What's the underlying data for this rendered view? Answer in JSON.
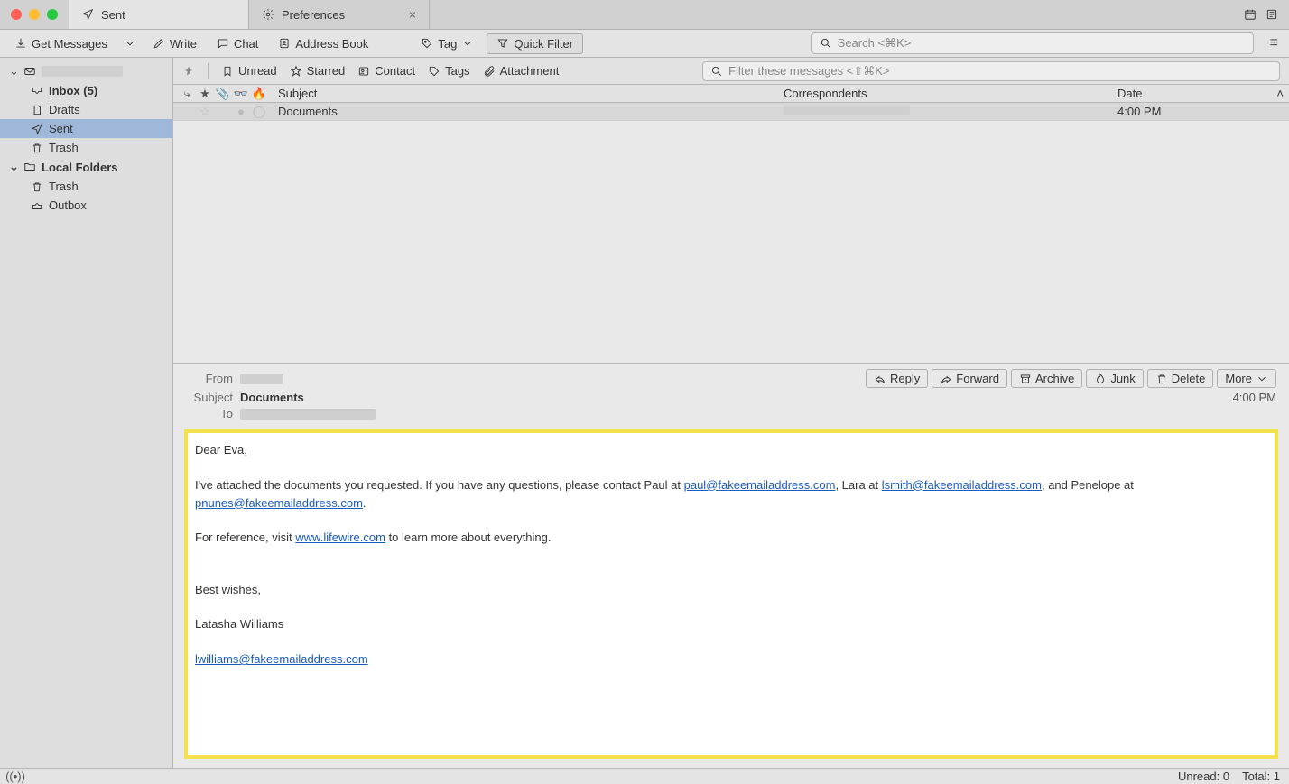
{
  "tabs": [
    {
      "label": "Sent",
      "icon": "paper-plane"
    },
    {
      "label": "Preferences",
      "icon": "gear",
      "closable": true
    }
  ],
  "toolbar": {
    "get_messages": "Get Messages",
    "write": "Write",
    "chat": "Chat",
    "address_book": "Address Book",
    "tag": "Tag",
    "quick_filter": "Quick Filter",
    "search_placeholder": "Search <⌘K>"
  },
  "folders": {
    "account_root": "",
    "inbox": "Inbox (5)",
    "drafts": "Drafts",
    "sent": "Sent",
    "trash": "Trash",
    "local_folders": "Local Folders",
    "local_trash": "Trash",
    "outbox": "Outbox"
  },
  "filterbar": {
    "unread": "Unread",
    "starred": "Starred",
    "contact": "Contact",
    "tags": "Tags",
    "attachment": "Attachment",
    "filter_placeholder": "Filter these messages <⇧⌘K>"
  },
  "columns": {
    "subject": "Subject",
    "correspondents": "Correspondents",
    "date": "Date"
  },
  "messages": [
    {
      "subject": "Documents",
      "correspondent": "",
      "date": "4:00 PM"
    }
  ],
  "preview": {
    "from_label": "From",
    "from_value": "",
    "subject_label": "Subject",
    "subject_value": "Documents",
    "to_label": "To",
    "to_value": "",
    "time": "4:00 PM",
    "actions": {
      "reply": "Reply",
      "forward": "Forward",
      "archive": "Archive",
      "junk": "Junk",
      "delete": "Delete",
      "more": "More"
    },
    "body": {
      "greeting": "Dear Eva,",
      "p1a": "I've attached the documents you requested. If you have any questions, please contact Paul at ",
      "email1": "paul@fakeemailaddress.com",
      "p1b": ", Lara at ",
      "email2": "lsmith@fakeemailaddress.com",
      "p1c": ", and Penelope at ",
      "email3": "pnunes@fakeemailaddress.com",
      "p1d": ".",
      "p2a": "For reference, visit ",
      "link1": "www.lifewire.com",
      "p2b": " to learn more about everything.",
      "closing": "Best wishes,",
      "name": "Latasha Williams",
      "sig_email": "lwilliams@fakeemailaddress.com"
    }
  },
  "status": {
    "unread": "Unread: 0",
    "total": "Total: 1"
  }
}
